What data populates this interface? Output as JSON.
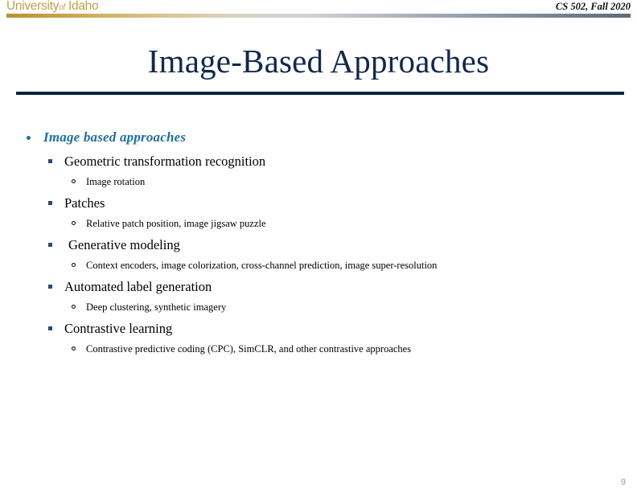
{
  "header": {
    "logo_university": "University",
    "logo_of": "of",
    "logo_name": "Idaho",
    "course": "CS 502, Fall 2020",
    "logo_color": "#bfa14a",
    "rule_gradient_start": "#b8912f",
    "rule_gradient_end": "#5f6a78"
  },
  "title": {
    "text": "Image-Based Approaches",
    "color": "#12284c",
    "rule_color": "#0d2240"
  },
  "content": {
    "level1": {
      "label": "Image based approaches",
      "color": "#1f7099"
    },
    "topics": [
      {
        "label": "Geometric transformation recognition",
        "details": [
          "Image rotation"
        ]
      },
      {
        "label": "Patches",
        "details": [
          "Relative patch position, image jigsaw puzzle"
        ]
      },
      {
        "label": "Generative modeling",
        "details": [
          "Context encoders, image colorization, cross-channel prediction, image super-resolution"
        ]
      },
      {
        "label": "Automated label generation",
        "details": [
          "Deep clustering, synthetic imagery"
        ]
      },
      {
        "label": "Contrastive learning",
        "details": [
          "Contrastive predictive coding (CPC), SimCLR, and other contrastive approaches"
        ]
      }
    ]
  },
  "footer": {
    "page_number": "9",
    "color": "#9a9a9a"
  }
}
